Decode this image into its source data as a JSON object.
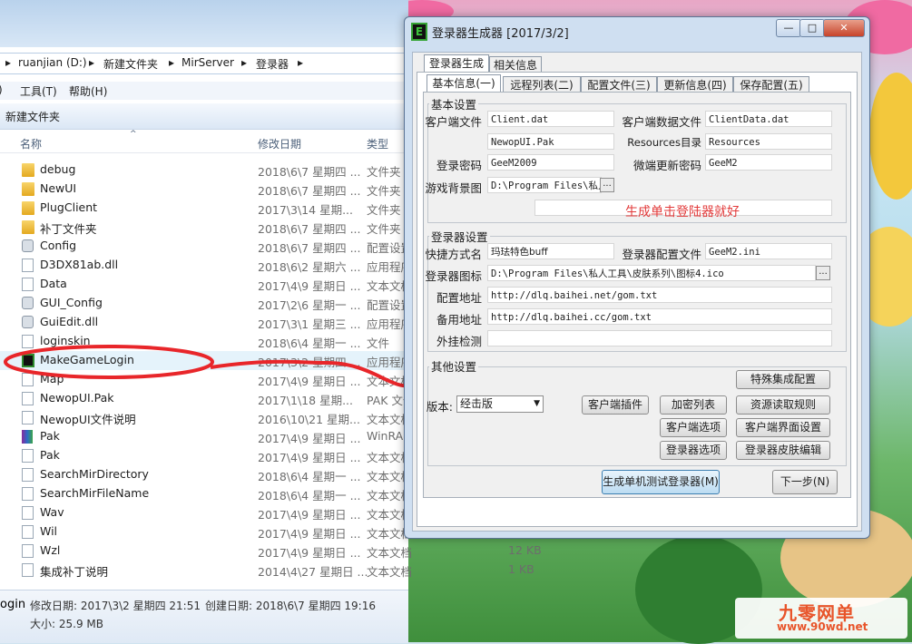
{
  "explorer": {
    "breadcrumb": [
      "ruanjian (D:)",
      "新建文件夹",
      "MirServer",
      "登录器"
    ],
    "menu": [
      "工具(T)",
      "帮助(H)"
    ],
    "toolbar_new_folder": "新建文件夹",
    "columns": {
      "name": "名称",
      "date": "修改日期",
      "type": "类型"
    },
    "rows": [
      {
        "icon": "folder",
        "name": "debug",
        "date": "2018\\6\\7 星期四 ...",
        "type": "文件夹",
        "size": ""
      },
      {
        "icon": "folder",
        "name": "NewUI",
        "date": "2018\\6\\7 星期四 ...",
        "type": "文件夹",
        "size": ""
      },
      {
        "icon": "folder",
        "name": "PlugClient",
        "date": "2017\\3\\14 星期...",
        "type": "文件夹",
        "size": ""
      },
      {
        "icon": "folder",
        "name": "补丁文件夹",
        "date": "2018\\6\\7 星期四 ...",
        "type": "文件夹",
        "size": ""
      },
      {
        "icon": "gear",
        "name": "Config",
        "date": "2018\\6\\7 星期四 ...",
        "type": "配置设置",
        "size": ""
      },
      {
        "icon": "file",
        "name": "D3DX81ab.dll",
        "date": "2018\\6\\2 星期六 ...",
        "type": "应用程序",
        "size": ""
      },
      {
        "icon": "file",
        "name": "Data",
        "date": "2017\\4\\9 星期日 ...",
        "type": "文本文档",
        "size": ""
      },
      {
        "icon": "gear",
        "name": "GUI_Config",
        "date": "2017\\2\\6 星期一 ...",
        "type": "配置设置",
        "size": ""
      },
      {
        "icon": "gear",
        "name": "GuiEdit.dll",
        "date": "2017\\3\\1 星期三 ...",
        "type": "应用程序",
        "size": ""
      },
      {
        "icon": "file",
        "name": "loginskin",
        "date": "2018\\6\\4 星期一 ...",
        "type": "文件",
        "size": ""
      },
      {
        "icon": "app",
        "name": "MakeGameLogin",
        "date": "2017\\3\\2 星期四 ...",
        "type": "应用程序",
        "size": ""
      },
      {
        "icon": "file",
        "name": "Map",
        "date": "2017\\4\\9 星期日 ...",
        "type": "文本文档",
        "size": ""
      },
      {
        "icon": "file",
        "name": "NewopUI.Pak",
        "date": "2017\\1\\18 星期...",
        "type": "PAK 文件",
        "size": ""
      },
      {
        "icon": "file",
        "name": "NewopUI文件说明",
        "date": "2016\\10\\21 星期...",
        "type": "文本文档",
        "size": ""
      },
      {
        "icon": "rar",
        "name": "Pak",
        "date": "2017\\4\\9 星期日 ...",
        "type": "WinRAR",
        "size": ""
      },
      {
        "icon": "file",
        "name": "Pak",
        "date": "2017\\4\\9 星期日 ...",
        "type": "文本文档",
        "size": ""
      },
      {
        "icon": "file",
        "name": "SearchMirDirectory",
        "date": "2018\\6\\4 星期一 ...",
        "type": "文本文档",
        "size": ""
      },
      {
        "icon": "file",
        "name": "SearchMirFileName",
        "date": "2018\\6\\4 星期一 ...",
        "type": "文本文档",
        "size": ""
      },
      {
        "icon": "file",
        "name": "Wav",
        "date": "2017\\4\\9 星期日 ...",
        "type": "文本文档",
        "size": ""
      },
      {
        "icon": "file",
        "name": "Wil",
        "date": "2017\\4\\9 星期日 ...",
        "type": "文本文档",
        "size": ""
      },
      {
        "icon": "file",
        "name": "Wzl",
        "date": "2017\\4\\9 星期日 ...",
        "type": "文本文档",
        "size": "12 KB"
      },
      {
        "icon": "file",
        "name": "集成补丁说明",
        "date": "2014\\4\\27 星期日 ...",
        "type": "文本文档",
        "size": "1 KB"
      }
    ],
    "status": {
      "name_tail": "ogin",
      "modified": "修改日期: 2017\\3\\2 星期四 21:51",
      "created": "创建日期: 2018\\6\\7 星期四 19:16",
      "size": "大小: 25.9 MB"
    }
  },
  "dialog": {
    "title": "登录器生成器 [2017/3/2]",
    "window_buttons": [
      "—",
      "□",
      "✕"
    ],
    "outer_tabs": [
      "登录器生成",
      "相关信息"
    ],
    "inner_tabs": [
      "基本信息(一)",
      "远程列表(二)",
      "配置文件(三)",
      "更新信息(四)",
      "保存配置(五)"
    ],
    "basic": {
      "group_label": "基本设置",
      "client_file_label": "客户端文件",
      "client_file_value": "Client.dat",
      "client_data_label": "客户端数据文件",
      "client_data_value": "ClientData.dat",
      "pak_value": "NewopUI.Pak",
      "resources_label": "Resources目录",
      "resources_value": "Resources",
      "password_label": "登录密码",
      "password_value": "GeeM2009",
      "micro_pwd_label": "微端更新密码",
      "micro_pwd_value": "GeeM2",
      "bg_label": "游戏背景图",
      "bg_value": "D:\\Program Files\\私人工",
      "browse": "..."
    },
    "annotation": "生成单击登陆器就好",
    "login": {
      "group_label": "登录器设置",
      "shortcut_label": "快捷方式名",
      "shortcut_value": "玛珐特色buff",
      "config_label": "登录器配置文件",
      "config_value": "GeeM2.ini",
      "icon_label": "登录器图标",
      "icon_value": "D:\\Program Files\\私人工具\\皮肤系列\\图标4.ico",
      "config_url_label": "配置地址",
      "config_url_value": "http://dlq.baihei.net/gom.txt",
      "backup_url_label": "备用地址",
      "backup_url_value": "http://dlq.baihei.cc/gom.txt",
      "plugin_check_label": "外挂检测",
      "plugin_check_value": ""
    },
    "other": {
      "group_label": "其他设置",
      "version_label": "版本:",
      "version_value": "经击版",
      "buttons": {
        "special": "特殊集成配置",
        "client_plugin": "客户端插件",
        "encrypt": "加密列表",
        "resource_rule": "资源读取规则",
        "client_options": "客户端选项",
        "client_ui": "客户端界面设置",
        "login_options": "登录器选项",
        "login_skin": "登录器皮肤编辑"
      }
    },
    "generate_button": "生成单机测试登录器(M)",
    "next_button": "下一步(N)"
  },
  "watermark": {
    "title": "九零网单",
    "url": "www.90wd.net"
  },
  "colors": {
    "annotation_red": "#e23a3a",
    "circle_red": "#e8262a",
    "accent": "#3c7fb1"
  }
}
